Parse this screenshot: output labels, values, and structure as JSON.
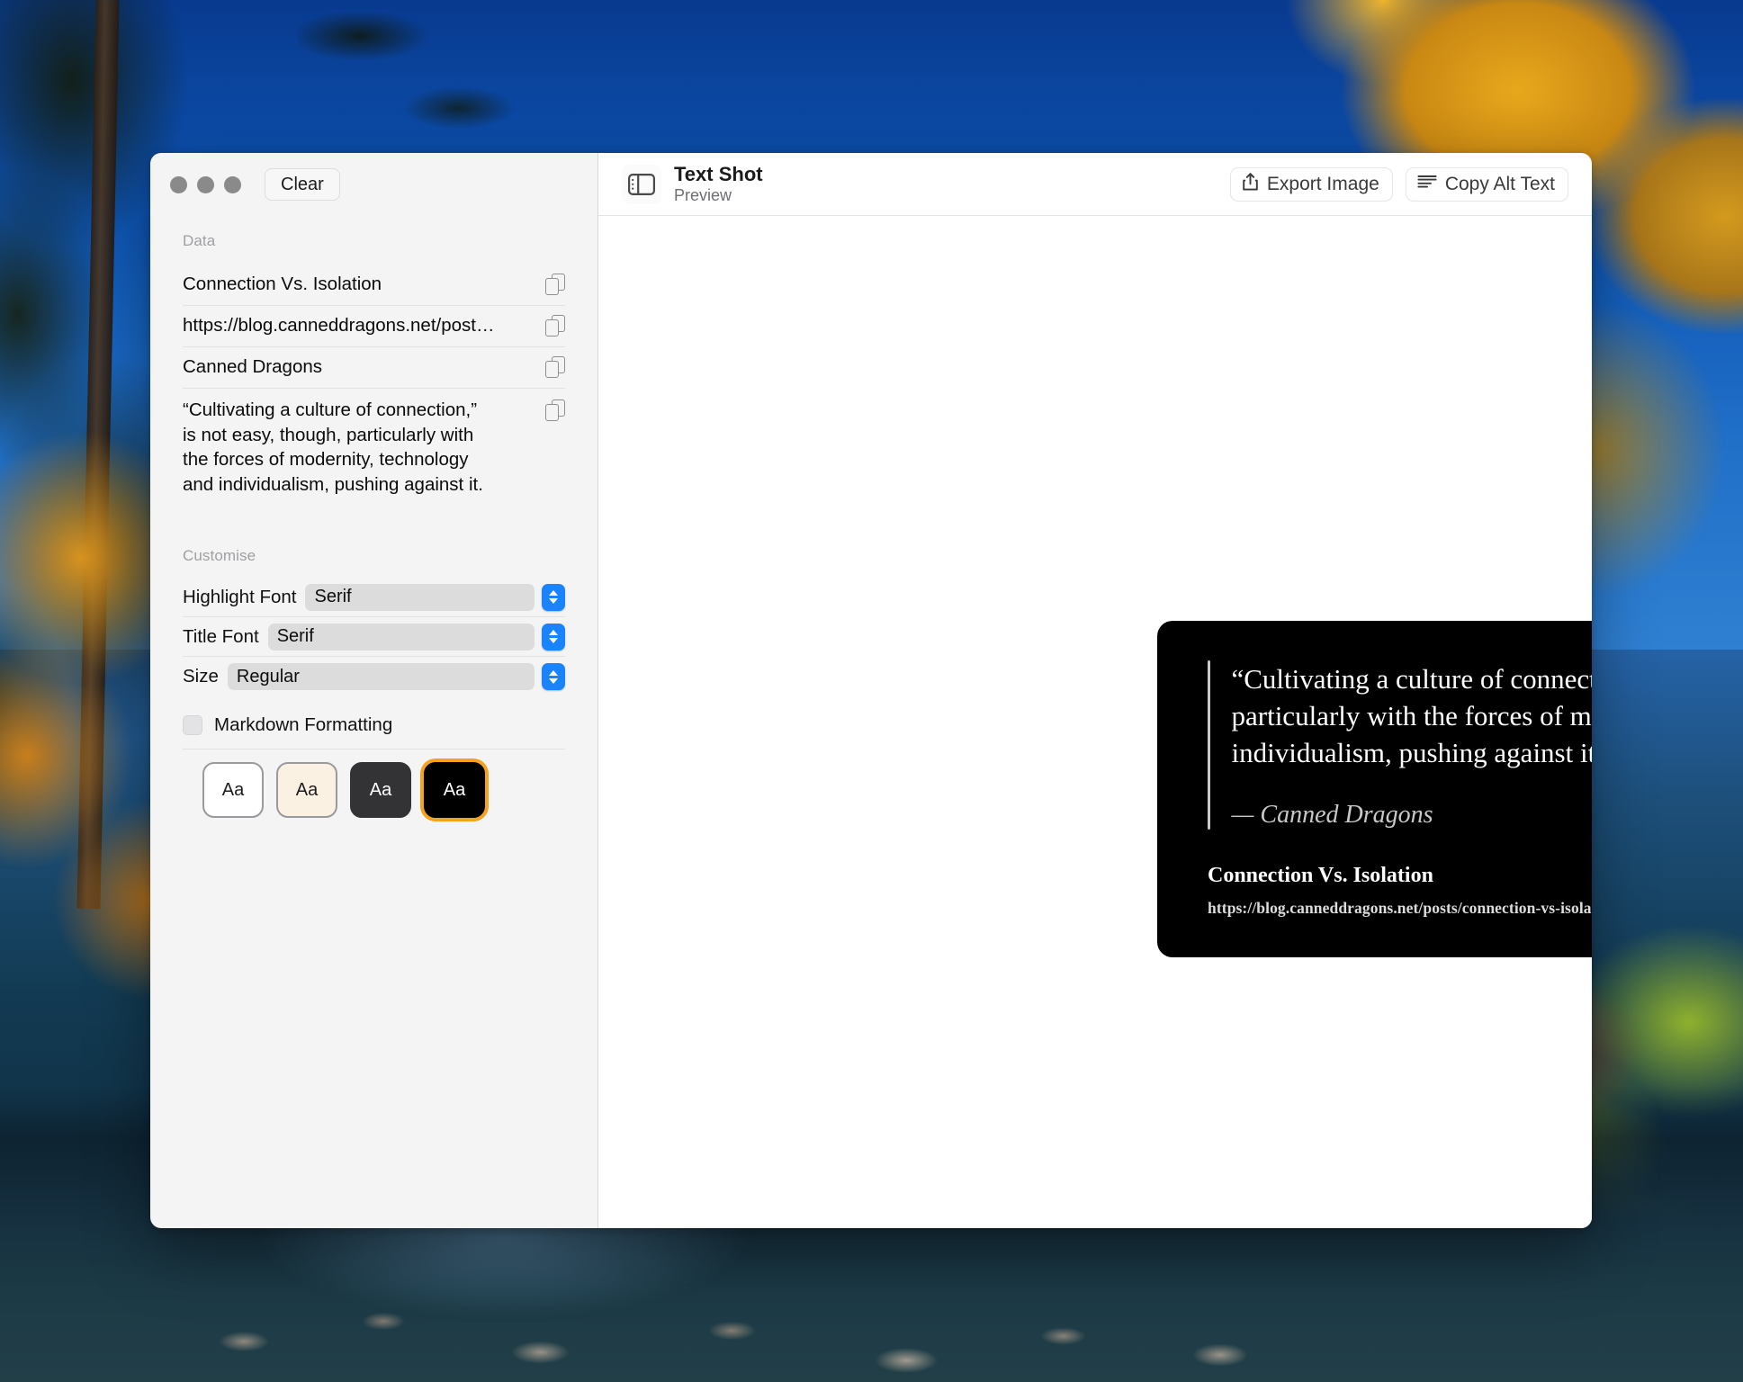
{
  "window": {
    "traffic_lights": [
      "close",
      "minimize",
      "zoom"
    ],
    "clear_label": "Clear"
  },
  "sidebar": {
    "data_section_label": "Data",
    "customise_section_label": "Customise",
    "data_fields": [
      {
        "name": "title",
        "value": "Connection Vs. Isolation",
        "copy_icon": "copy-icon"
      },
      {
        "name": "url",
        "value": "https://blog.canneddragons.net/post…",
        "copy_icon": "copy-icon"
      },
      {
        "name": "author",
        "value": "Canned Dragons",
        "copy_icon": "copy-icon"
      },
      {
        "name": "highlight",
        "value": "“Cultivating a culture of connection,”\nis not easy, though, particularly with\nthe forces of modernity, technology\nand individualism, pushing against it.",
        "copy_icon": "copy-icon"
      }
    ],
    "controls": [
      {
        "label": "Highlight Font",
        "value": "Serif"
      },
      {
        "label": "Title Font",
        "value": "Serif"
      },
      {
        "label": "Size",
        "value": "Regular"
      }
    ],
    "markdown": {
      "label": "Markdown Formatting",
      "checked": false
    },
    "themes": [
      {
        "name": "light",
        "sample": "Aa",
        "bg": "#ffffff",
        "fg": "#1c1c1e",
        "selected": false
      },
      {
        "name": "cream",
        "sample": "Aa",
        "bg": "#fbf1e2",
        "fg": "#1c1c1e",
        "selected": false
      },
      {
        "name": "graphite",
        "sample": "Aa",
        "bg": "#333336",
        "fg": "#ffffff",
        "selected": false
      },
      {
        "name": "black",
        "sample": "Aa",
        "bg": "#000000",
        "fg": "#ffffff",
        "selected": true
      }
    ]
  },
  "toolbar": {
    "app_icon": "sidebar-layout-icon",
    "title": "Text Shot",
    "subtitle": "Preview",
    "export_label": "Export Image",
    "export_icon": "share-icon",
    "copy_alt_label": "Copy Alt Text",
    "copy_alt_icon": "text-lines-icon"
  },
  "preview": {
    "background": "#000000",
    "quote": "“Cultivating a culture of connection,” is not easy, though, particularly with the forces of modernity, technology and individualism, pushing against it.",
    "attribution": "— Canned Dragons",
    "title": "Connection Vs. Isolation",
    "url": "https://blog.canneddragons.net/posts/connection-vs-isolation",
    "accent_rule_color": "#c8c8c8"
  },
  "colors": {
    "accent_blue": "#1a84ff",
    "selection_orange": "#f5a21f",
    "sidebar_bg": "#f4f4f4",
    "detail_bg": "#ffffff"
  }
}
